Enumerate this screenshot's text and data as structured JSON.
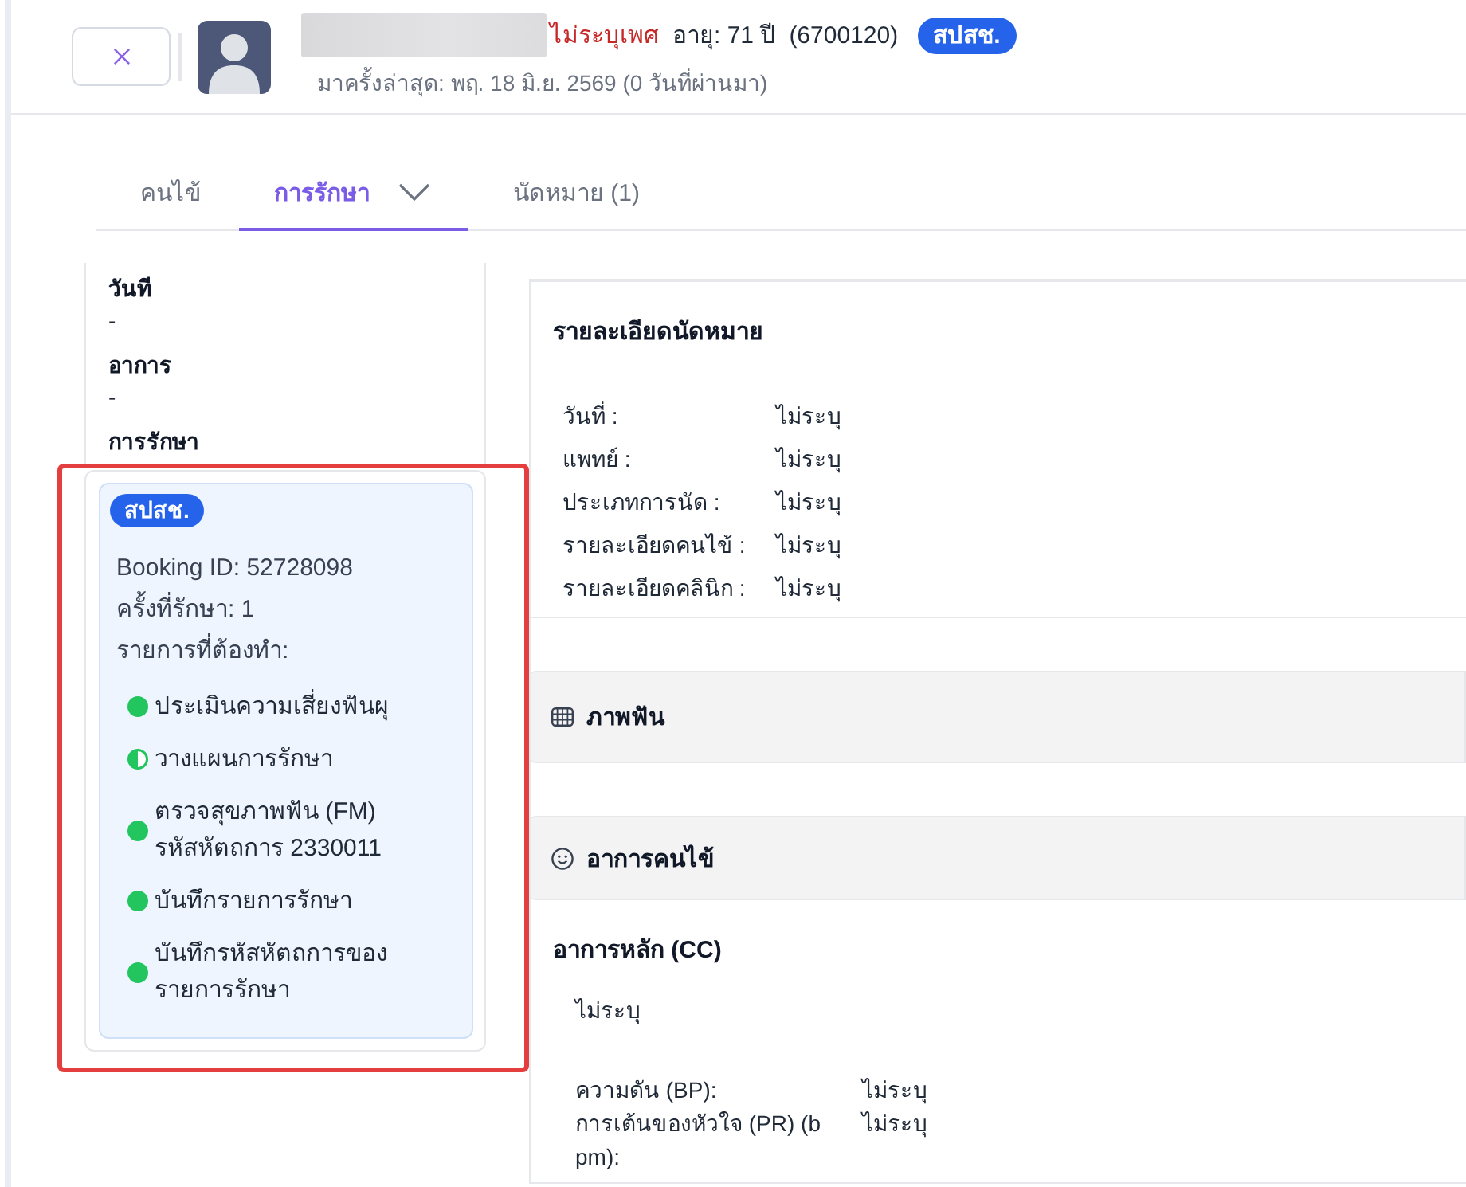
{
  "header": {
    "gender": "ไม่ระบุเพศ",
    "age": "อายุ: 71 ปี",
    "patient_id": "(6700120)",
    "badge": "สปสช.",
    "last_visit": "มาครั้งล่าสุด: พฤ. 18 มิ.ย. 2569 (0 วันที่ผ่านมา)"
  },
  "tabs": [
    {
      "label": "คนไข้",
      "selected": false,
      "has_dropdown": false
    },
    {
      "label": "การรักษา",
      "selected": true,
      "has_dropdown": true
    },
    {
      "label": "นัดหมาย (1)",
      "selected": false,
      "has_dropdown": false
    }
  ],
  "summary": {
    "fields": [
      {
        "label": "วันที",
        "value": "-"
      },
      {
        "label": "อาการ",
        "value": "-"
      }
    ],
    "treatment_label": "การรักษา"
  },
  "treatment_card": {
    "highlighted": true,
    "badge": "สปสช.",
    "lines": [
      "Booking ID: 52728098",
      "ครั้งที่รักษา: 1",
      "รายการที่ต้องทำ:"
    ],
    "tasks": [
      {
        "label": "ประเมินความเสี่ยงฟันผุ",
        "completed": true
      },
      {
        "label": "วางแผนการรักษา",
        "completed": false
      },
      {
        "label": "ตรวจสุขภาพฟัน (FM)",
        "code": "รหัสหัตถการ 2330011",
        "completed": true
      },
      {
        "label": "บันทึกรายการรักษา",
        "completed": true
      },
      {
        "label": "บันทึกรหัสหัตถการของรายการรักษา",
        "completed": true
      }
    ]
  },
  "appointment": {
    "title": "รายละเอียดนัดหมาย",
    "rows": [
      {
        "label": "วันที่ :",
        "value": "ไม่ระบุ"
      },
      {
        "label": "แพทย์ :",
        "value": "ไม่ระบุ"
      },
      {
        "label": "ประเภทการนัด :",
        "value": "ไม่ระบุ"
      },
      {
        "label": "รายละเอียดคนไข้ :",
        "value": "ไม่ระบุ"
      },
      {
        "label": "รายละเอียดคลินิก :",
        "value": "ไม่ระบุ"
      }
    ]
  },
  "sections": [
    {
      "kind": "dental_chart",
      "title": "ภาพฟัน"
    },
    {
      "kind": "symptoms",
      "title": "อาการคนไข้",
      "chief_complaint": {
        "heading": "อาการหลัก (CC)",
        "value": "ไม่ระบุ"
      },
      "vitals": [
        {
          "label": "ความดัน (BP):",
          "value": "ไม่ระบุ"
        },
        {
          "label": "การเต้นของหัวใจ (PR) (bpm):",
          "value": "ไม่ระบุ"
        }
      ]
    }
  ]
}
